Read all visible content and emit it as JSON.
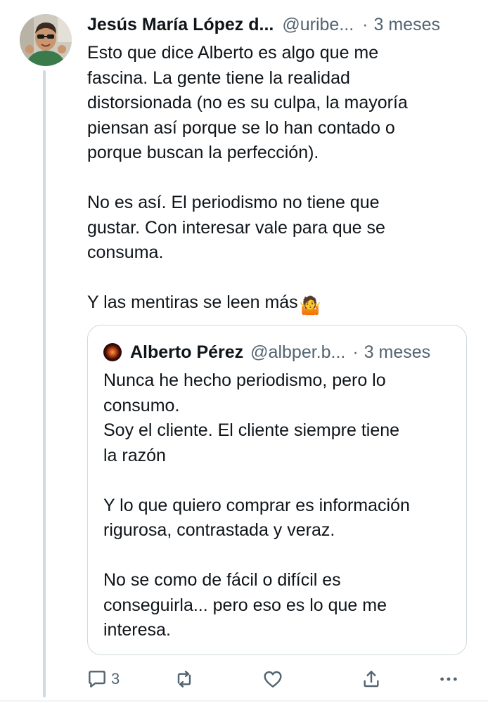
{
  "author": {
    "display_name": "Jesús María López d...",
    "handle": "@uribe...",
    "separator": "·",
    "time": "3 meses"
  },
  "tweet": {
    "text": "Esto que dice Alberto es algo que me\nfascina. La gente tiene la realidad\ndistorsionada (no es su culpa, la mayoría\npiensan así porque se lo han contado o\nporque buscan la perfección).\n\nNo es así. El periodismo no tiene que\ngustar. Con interesar vale para que se\nconsuma.\n\nY las mentiras se leen más",
    "emoji": "🤷"
  },
  "quote": {
    "display_name": "Alberto Pérez",
    "handle": "@albper.b...",
    "separator": "·",
    "time": "3 meses",
    "text": "Nunca he hecho periodismo, pero lo\nconsumo.\nSoy el cliente. El cliente siempre tiene\nla razón\n\nY lo que quiero comprar es información\nrigurosa, contrastada y veraz.\n\nNo se como de fácil o difícil es\nconseguirla... pero eso es lo que me\ninteresa."
  },
  "actions": {
    "reply_count": "3",
    "icons": [
      "reply-icon",
      "repost-icon",
      "like-icon",
      "share-icon",
      "more-icon"
    ]
  },
  "colors": {
    "text": "#0f1419",
    "secondary": "#536471",
    "border": "#cfd9de"
  }
}
